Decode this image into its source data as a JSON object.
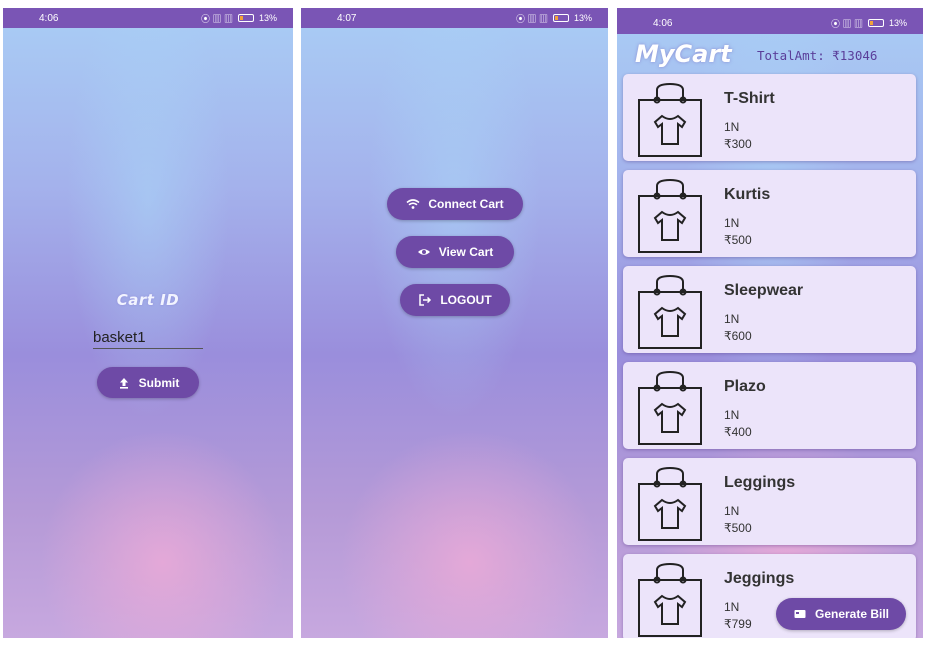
{
  "screen1": {
    "status": {
      "time": "4:06",
      "battery": "13%"
    },
    "title": "Cart ID",
    "cart_id_value": "basket1",
    "submit_label": "Submit"
  },
  "screen2": {
    "status": {
      "time": "4:07",
      "battery": "13%"
    },
    "connect_label": "Connect Cart",
    "view_label": "View Cart",
    "logout_label": "LOGOUT"
  },
  "screen3": {
    "status": {
      "time": "4:06",
      "battery": "13%"
    },
    "app_title": "MyCart",
    "total": "TotalAmt: ₹13046",
    "items": [
      {
        "name": "T-Shirt",
        "qty": "1N",
        "price": "₹300"
      },
      {
        "name": "Kurtis",
        "qty": "1N",
        "price": "₹500"
      },
      {
        "name": "Sleepwear",
        "qty": "1N",
        "price": "₹600"
      },
      {
        "name": "Plazo",
        "qty": "1N",
        "price": "₹400"
      },
      {
        "name": "Leggings",
        "qty": "1N",
        "price": "₹500"
      },
      {
        "name": "Jeggings",
        "qty": "1N",
        "price": "₹799"
      }
    ],
    "generate_bill_label": "Generate Bill"
  },
  "icons": [
    "upload-icon",
    "wifi-icon",
    "eye-icon",
    "logout-icon",
    "shopping-bag-icon",
    "bill-icon"
  ],
  "colors": {
    "accent": "#6e4aa6",
    "statusbar": "#7a55b5",
    "card": "#ece4fa"
  }
}
